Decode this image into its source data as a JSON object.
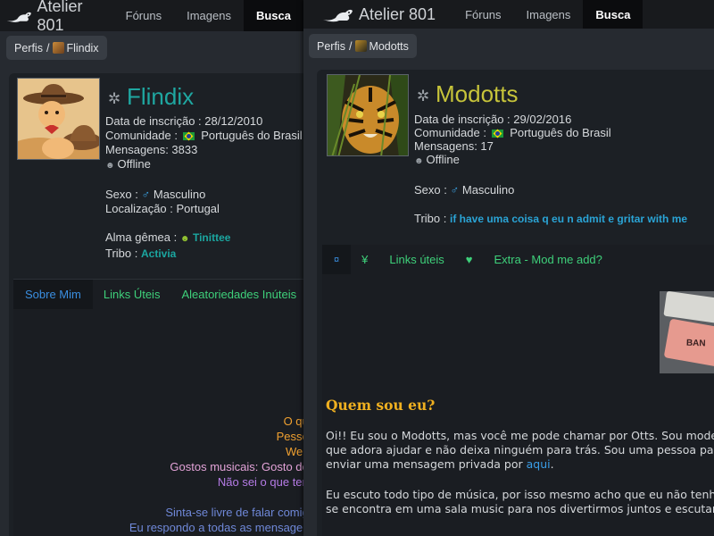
{
  "left": {
    "header": {
      "app_name": "Atelier 801",
      "nav": [
        "Fóruns",
        "Imagens",
        "Busca"
      ]
    },
    "breadcrumb": {
      "root": "Perfis",
      "separator": "/",
      "current": "Flindix"
    },
    "profile": {
      "name": "Flindix",
      "registration": "Data de inscrição : 28/12/2010",
      "community_label": "Comunidade :",
      "community_value": "Português do Brasil",
      "messages": "Mensagens: 3833",
      "status": "Offline",
      "sex_label": "Sexo :",
      "sex_value": "Masculino",
      "location": "Localização : Portugal",
      "soulmate_label": "Alma gêmea :",
      "soulmate_value": "Tinittee",
      "tribe_label": "Tribo :",
      "tribe_value": "Activia"
    },
    "tabs": [
      "Sobre Mim",
      "Links Úteis",
      "Aleatoriedades Inúteis"
    ],
    "bio_lines": [
      "O que",
      "Pessoa",
      "Webs",
      "Gostos musicais: Gosto de t",
      "Não sei o que tenh",
      "Sinta-se livre de falar comigo",
      "Eu respondo a todas as mensagens"
    ]
  },
  "right": {
    "header": {
      "app_name": "Atelier 801",
      "nav": [
        "Fóruns",
        "Imagens",
        "Busca"
      ]
    },
    "breadcrumb": {
      "root": "Perfis",
      "separator": "/",
      "current": "Modotts"
    },
    "profile": {
      "name": "Modotts",
      "registration": "Data de inscrição : 29/02/2016",
      "community_label": "Comunidade :",
      "community_value": "Português do Brasil",
      "messages": "Mensagens: 17",
      "status": "Offline",
      "sex_label": "Sexo :",
      "sex_value": "Masculino",
      "tribe_label": "Tribo :",
      "tribe_value": "if have uma coisa q eu n admit e gritar with me"
    },
    "tabs": [
      "¤",
      "¥",
      "Links úteis",
      "♥",
      "Extra - Mod me add?"
    ],
    "keyboard_key": "BAN",
    "bio_heading": "Quem sou eu?",
    "bio_p1_lines": [
      "Oi!! Eu sou o Modotts, mas você me pode chamar por Otts. Sou moder",
      "que adora ajudar e não deixa ninguém para trás. Sou uma pessoa pac"
    ],
    "bio_p1_end_prefix": "enviar uma mensagem privada por ",
    "bio_p1_link": "aqui",
    "bio_p1_end_suffix": ".",
    "bio_p2_lines": [
      "Eu escuto todo tipo de música, por isso mesmo acho que eu não tenho",
      "se encontra em uma sala music para nos divertirmos juntos e escutar to"
    ]
  }
}
